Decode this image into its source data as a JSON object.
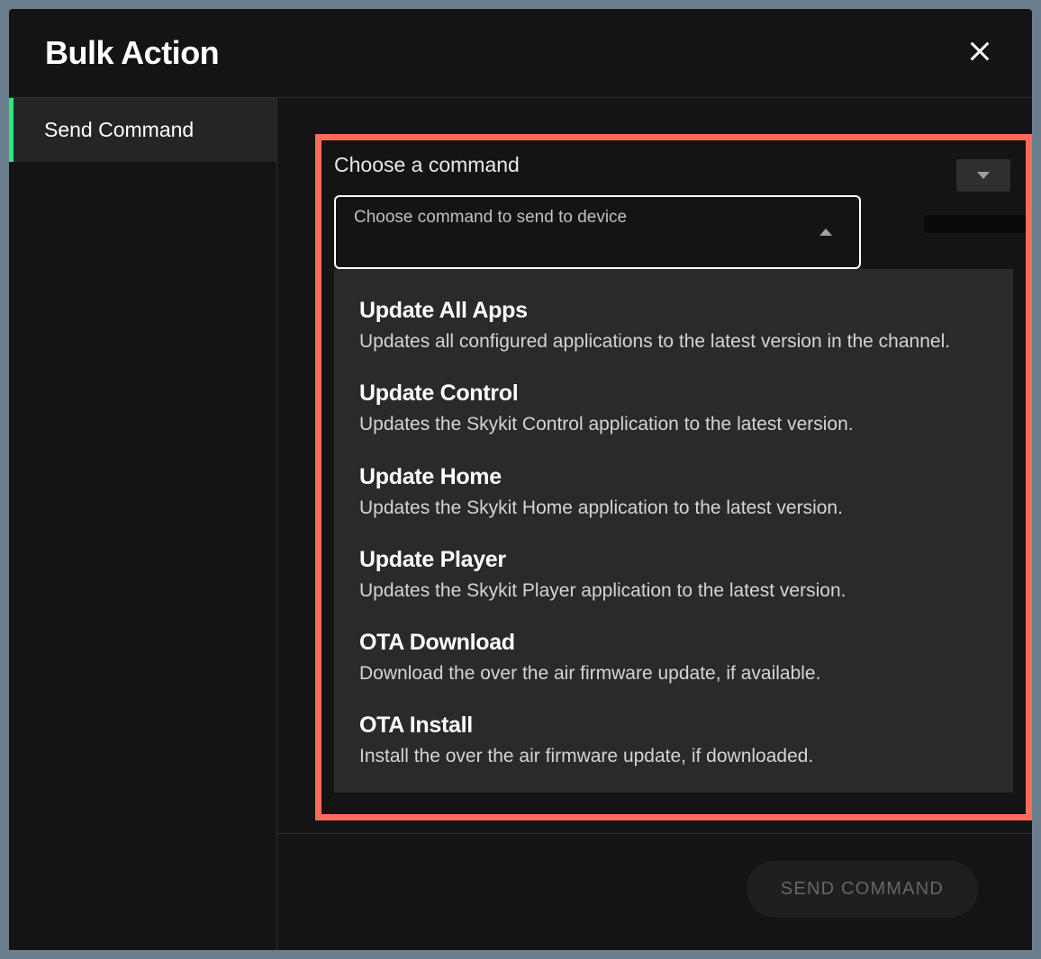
{
  "modal": {
    "title": "Bulk Action"
  },
  "sidebar": {
    "items": [
      {
        "label": "Send Command"
      }
    ]
  },
  "command": {
    "label": "Choose a command",
    "placeholder": "Choose command to send to device",
    "options": [
      {
        "title": "Update All Apps",
        "desc": "Updates all configured applications to the latest version in the channel."
      },
      {
        "title": "Update Control",
        "desc": "Updates the Skykit Control application to the latest version."
      },
      {
        "title": "Update Home",
        "desc": "Updates the Skykit Home application to the latest version."
      },
      {
        "title": "Update Player",
        "desc": "Updates the Skykit Player application to the latest version."
      },
      {
        "title": "OTA Download",
        "desc": "Download the over the air firmware update, if available."
      },
      {
        "title": "OTA Install",
        "desc": "Install the over the air firmware update, if downloaded."
      }
    ]
  },
  "footer": {
    "send_command_label": "SEND COMMAND"
  }
}
